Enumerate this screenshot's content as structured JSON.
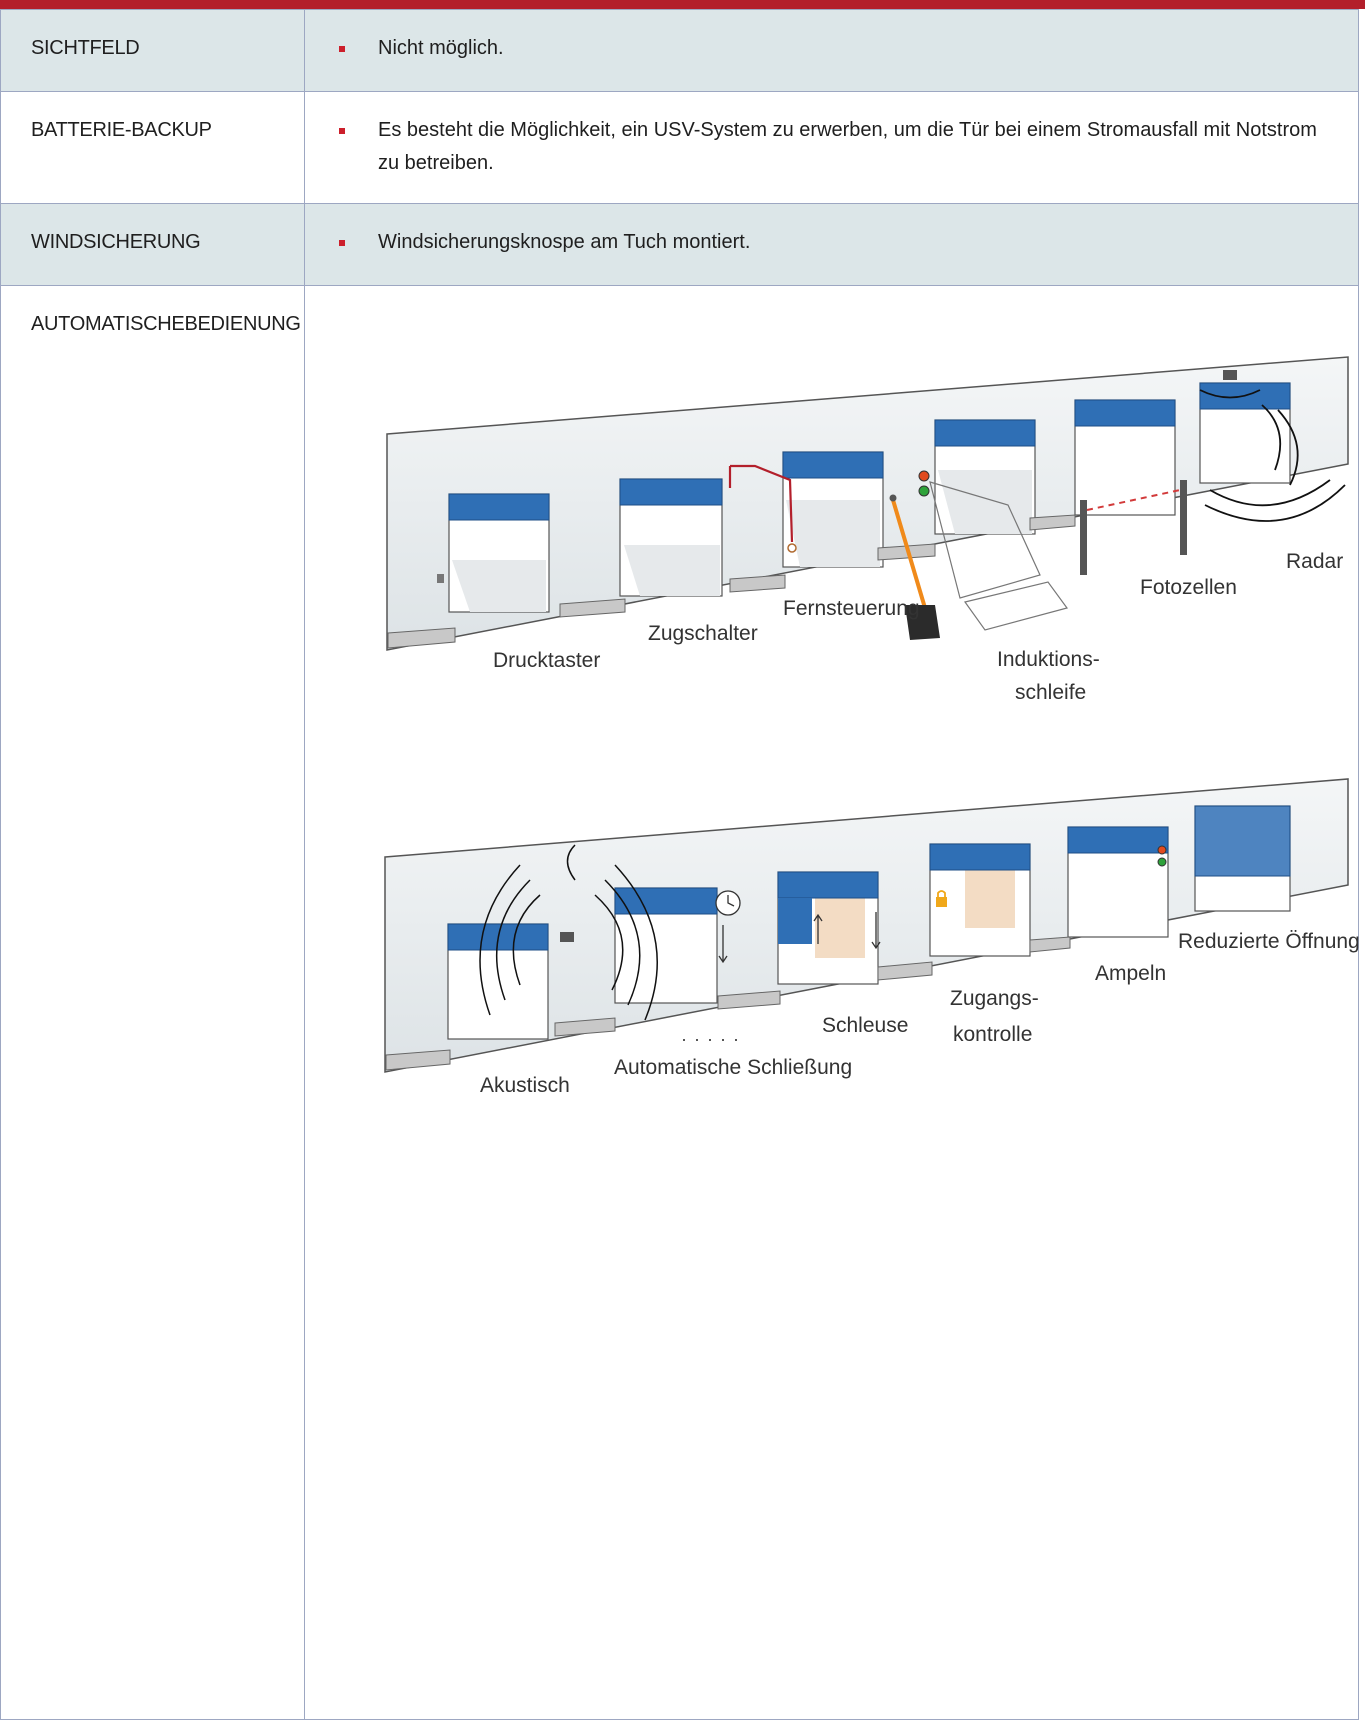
{
  "rows": [
    {
      "label": "SICHTFELD",
      "value": "Nicht möglich."
    },
    {
      "label": "BATTERIE-BACKUP",
      "value": "Es besteht die Möglichkeit, ein USV-System zu erwerben, um die Tür bei einem Stromausfall mit Notstrom zu betreiben."
    },
    {
      "label": "WINDSICHERUNG",
      "value": "Windsicherungsknospe am Tuch montiert."
    },
    {
      "label": "AUTOMATISCHEBEDIENUNG",
      "value": ""
    }
  ],
  "diagram": {
    "top_labels": [
      "Drucktaster",
      "Zugschalter",
      "Fernsteuerung",
      "Induktions-",
      "schleife",
      "Fotozellen",
      "Radar"
    ],
    "bottom_labels": [
      "Akustisch",
      "Automatische Schließung",
      "Schleuse",
      "Zugangs-",
      "kontrolle",
      "Ampeln",
      "Reduzierte Öffnung"
    ]
  },
  "colors": {
    "accent_red": "#b31f2b",
    "door_blue": "#2f6fb5",
    "row_shade": "#dce6e8",
    "border": "#9da7c2"
  }
}
